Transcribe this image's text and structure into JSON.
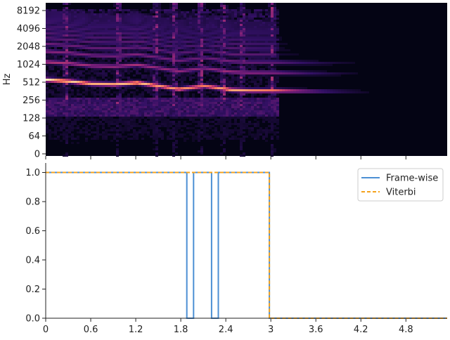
{
  "chart_data": [
    {
      "type": "heatmap",
      "ylabel": "Hz",
      "yscale": "log2",
      "yticks": [
        "0",
        "64",
        "128",
        "256",
        "512",
        "1024",
        "2048",
        "4096",
        "8192"
      ],
      "xlim": [
        0,
        5.35
      ],
      "colormap": "magma",
      "background": "#040414",
      "grid": false,
      "harmonic_tracks": [
        {
          "t": [
            0,
            0.3,
            0.6,
            0.9,
            1.2,
            1.5,
            1.75,
            2.1,
            2.45,
            2.7,
            3.0,
            3.5,
            4.0,
            4.5
          ],
          "hz": [
            560,
            530,
            480,
            470,
            500,
            440,
            390,
            440,
            380,
            370,
            370,
            360,
            355,
            350
          ],
          "strength": [
            1,
            0.95,
            0.9,
            0.9,
            0.95,
            0.85,
            0.85,
            0.8,
            0.9,
            0.85,
            0.8,
            0.6,
            0.4,
            0.2
          ]
        }
      ]
    },
    {
      "type": "line",
      "x": [
        0,
        1.88,
        1.88,
        1.97,
        1.97,
        2.21,
        2.21,
        2.3,
        2.3,
        2.98,
        2.98,
        5.35
      ],
      "series": [
        {
          "name": "Frame-wise",
          "color": "#4c8fd4",
          "style": "solid",
          "y": [
            1,
            1,
            0,
            0,
            1,
            1,
            0,
            0,
            1,
            1,
            0,
            0
          ]
        },
        {
          "name": "Viterbi",
          "color": "#f5a21c",
          "style": "dashed",
          "y": [
            1,
            1,
            1,
            1,
            1,
            1,
            1,
            1,
            1,
            1,
            0,
            0
          ]
        }
      ],
      "xticks": [
        "0",
        "0.6",
        "1.2",
        "1.8",
        "2.4",
        "3",
        "3.6",
        "4.2",
        "4.8"
      ],
      "yticks": [
        "0.0",
        "0.2",
        "0.4",
        "0.6",
        "0.8",
        "1.0"
      ],
      "xlim": [
        0,
        5.35
      ],
      "ylim": [
        0,
        1
      ],
      "grid": false,
      "legend_position": "top-right"
    }
  ]
}
